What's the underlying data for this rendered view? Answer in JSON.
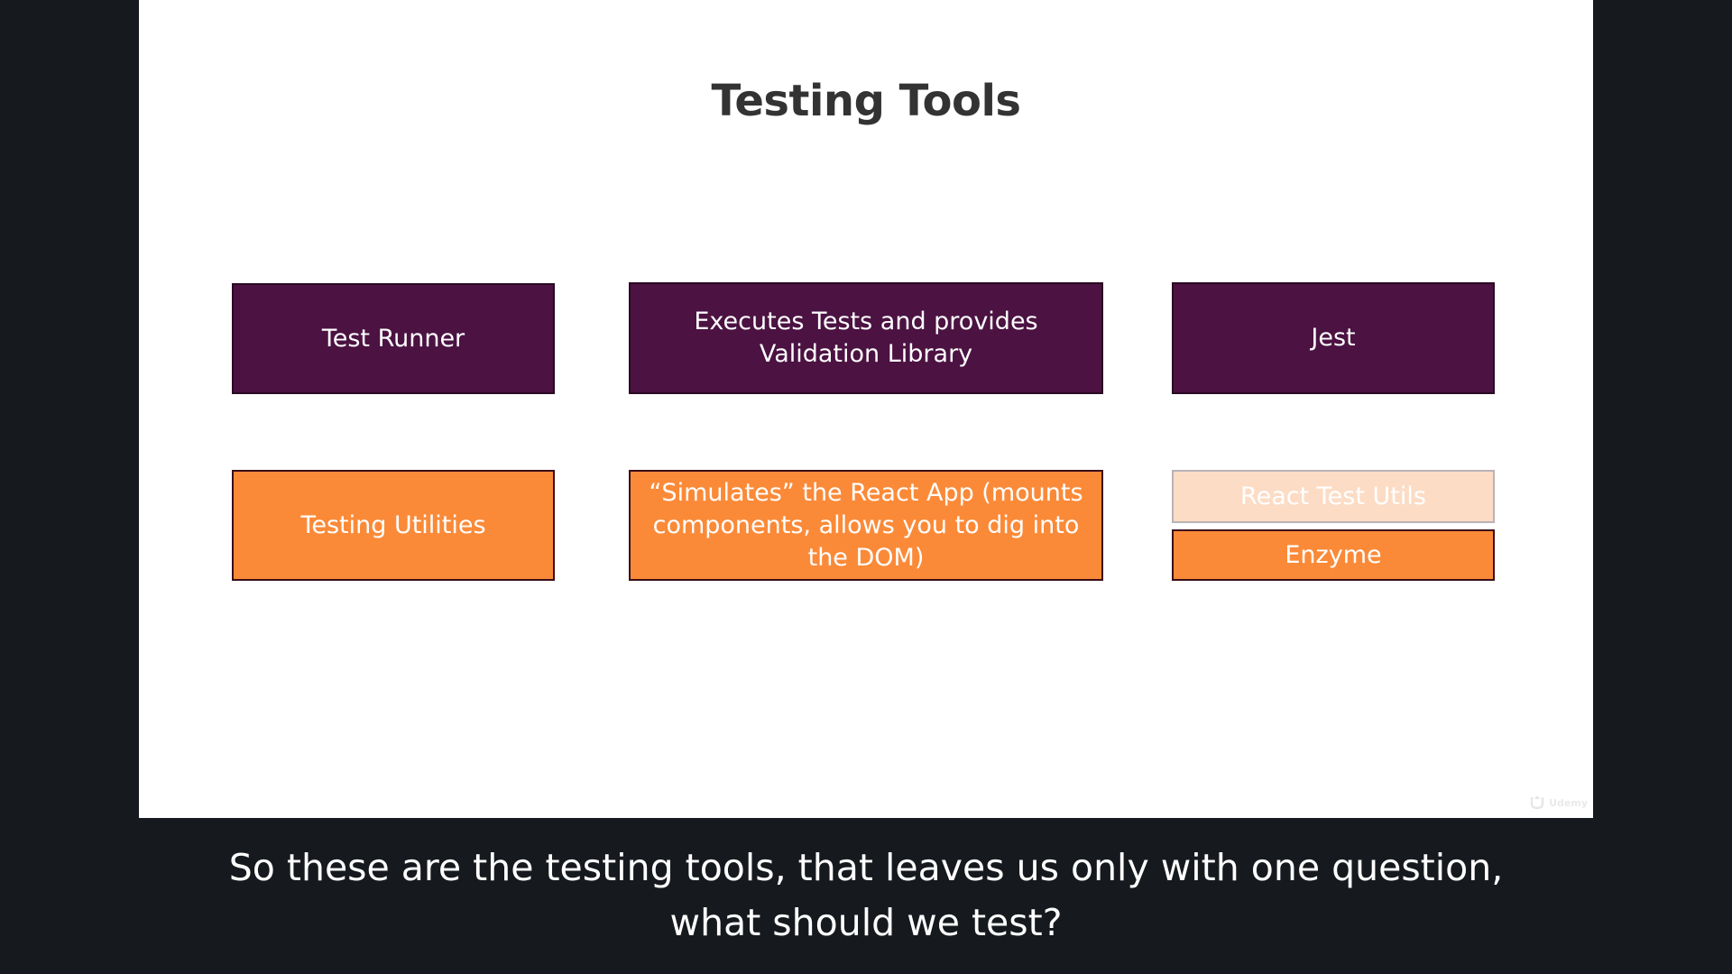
{
  "slide": {
    "title": "Testing Tools",
    "rows": [
      {
        "category": "Test Runner",
        "description_lines": [
          "Executes Tests and provides",
          "Validation Library"
        ],
        "tools": [
          "Jest"
        ]
      },
      {
        "category": "Testing Utilities",
        "description_lines": [
          "“Simulates” the React App (mounts",
          "components, allows you to dig into",
          "the DOM)"
        ],
        "tools": [
          "React Test Utils",
          "Enzyme"
        ]
      }
    ],
    "watermark": "Udemy"
  },
  "caption": {
    "lines": [
      "So these are the testing tools, that leaves us only with one question,",
      "what should we test?"
    ]
  },
  "colors": {
    "background": "#16191e",
    "slide": "#ffffff",
    "purple": "#4b1242",
    "orange": "#fb8a38",
    "faded_orange": "#fcdcc5",
    "title_text": "#333333"
  }
}
